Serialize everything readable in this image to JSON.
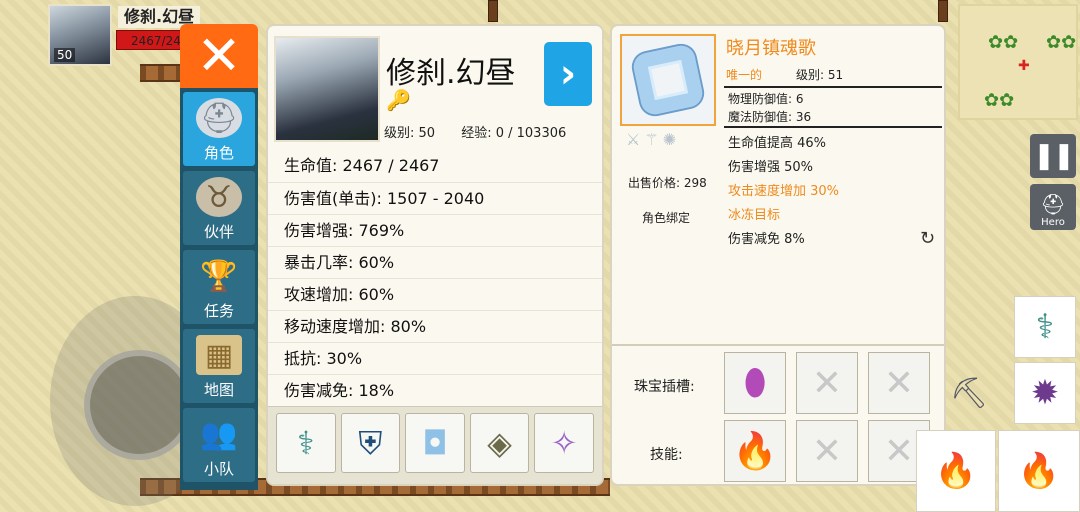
{
  "hud": {
    "player_name": "修刹.幻昼",
    "hp_text": "2467/24",
    "level": "50"
  },
  "menu": {
    "items": [
      {
        "label": "角色",
        "icon": "knight-helmet-icon",
        "active": true
      },
      {
        "label": "伙伴",
        "icon": "horned-helmet-icon",
        "active": false
      },
      {
        "label": "任务",
        "icon": "trophy-icon",
        "active": false
      },
      {
        "label": "地图",
        "icon": "map-scroll-icon",
        "active": false
      },
      {
        "label": "小队",
        "icon": "party-icon",
        "active": false
      }
    ]
  },
  "character": {
    "name": "修刹.幻昼",
    "level_label": "级别: 50",
    "exp_label": "经验: 0 / 103306",
    "stats": [
      "生命值: 2467 / 2467",
      "伤害值(单击): 1507 - 2040",
      "伤害增强: 769%",
      "暴击几率: 60%",
      "攻速增加: 60%",
      "移动速度增加: 80%",
      "抵抗: 30%",
      "伤害减免: 18%"
    ],
    "equipment": [
      {
        "icon": "staff-icon"
      },
      {
        "icon": "armor-icon"
      },
      {
        "icon": "ring-icon"
      },
      {
        "icon": "bracer-icon"
      },
      {
        "icon": "feather-icon"
      }
    ]
  },
  "item": {
    "name": "晓月镇魂歌",
    "rarity": "唯一的",
    "level_label": "级别: 51",
    "phys_def": "物理防御值: 6",
    "mag_def": "魔法防御值: 36",
    "sell_price": "出售价格: 298",
    "bind": "角色绑定",
    "attributes": [
      {
        "text": "生命值提高 46%",
        "color": "white"
      },
      {
        "text": "伤害增强 50%",
        "color": "white"
      },
      {
        "text": "攻击速度增加 30%",
        "color": "orange"
      },
      {
        "text": "冰冻目标",
        "color": "orange"
      },
      {
        "text": "伤害减免 8%",
        "color": "white"
      }
    ],
    "socket_label": "珠宝插槽:",
    "skill_label": "技能:"
  },
  "side": {
    "hero_label": "Hero"
  },
  "colors": {
    "accent_orange": "#ff6a13",
    "accent_blue": "#1fa4e6",
    "rarity_orange": "#ef8a1e",
    "menu_bg": "#1f5368"
  }
}
